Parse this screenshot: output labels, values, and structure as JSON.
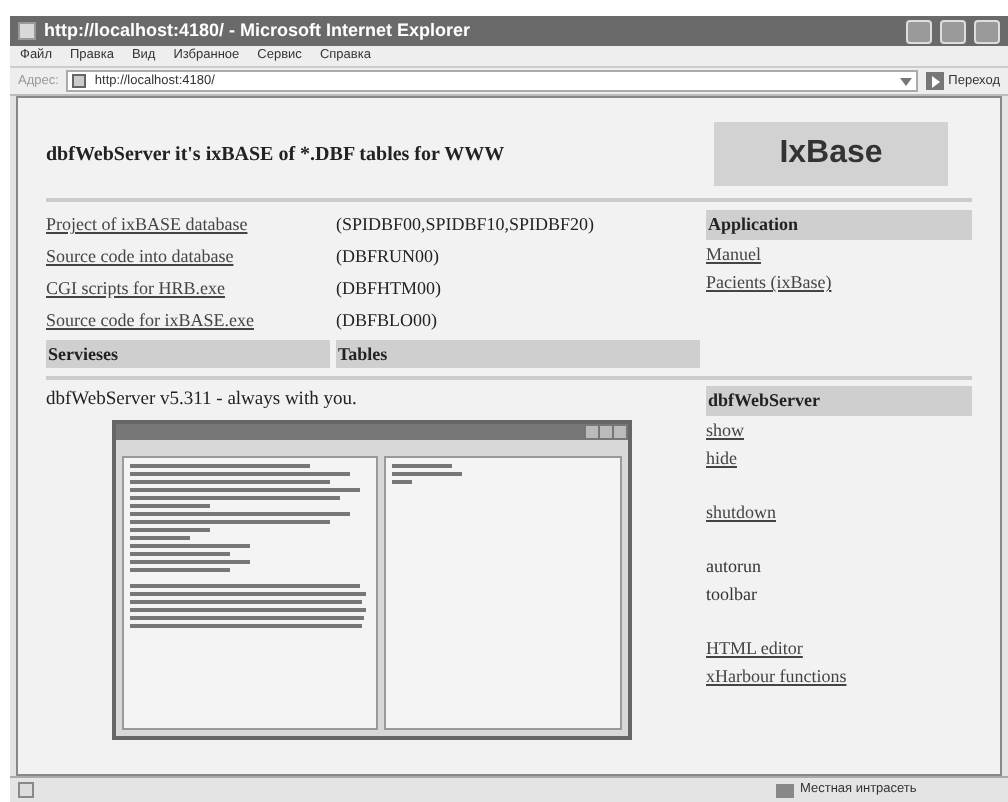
{
  "window": {
    "title": "http://localhost:4180/ - Microsoft Internet Explorer"
  },
  "menu": [
    "Файл",
    "Правка",
    "Вид",
    "Избранное",
    "Сервис",
    "Справка"
  ],
  "address_bar": {
    "label": "Адрес:",
    "value": "http://localhost:4180/",
    "go": "Переход"
  },
  "page": {
    "heading": "dbfWebServer it's ixBASE of *.DBF tables for WWW",
    "logo": "IxBase",
    "links": [
      {
        "label": "Project of ixBASE database",
        "code": "(SPIDBF00,SPIDBF10,SPIDBF20)"
      },
      {
        "label": "Source code into database",
        "code": "(DBFRUN00)"
      },
      {
        "label": "CGI scripts for HRB.exe",
        "code": "(DBFHTM00)"
      },
      {
        "label": "Source code for ixBASE.exe",
        "code": "(DBFBLO00)"
      }
    ],
    "section_headers": [
      "Servieses",
      "Tables"
    ],
    "application": {
      "header": "Application",
      "items": [
        {
          "label": "Manuel",
          "kind": "link"
        },
        {
          "label": "Pacients (ixBase)",
          "kind": "link"
        }
      ]
    },
    "tagline": "dbfWebServer v5.311 - always with you.",
    "server": {
      "header": "dbfWebServer",
      "items": [
        {
          "label": "show",
          "kind": "link"
        },
        {
          "label": "hide",
          "kind": "link"
        },
        {
          "label": "shutdown",
          "kind": "link",
          "gap": true
        },
        {
          "label": "autorun",
          "kind": "text",
          "gap": true
        },
        {
          "label": "toolbar",
          "kind": "text"
        },
        {
          "label": "HTML editor",
          "kind": "link",
          "gap": true
        },
        {
          "label": "xHarbour functions",
          "kind": "link"
        }
      ]
    }
  },
  "status_bar": {
    "zone": "Местная интрасеть"
  }
}
